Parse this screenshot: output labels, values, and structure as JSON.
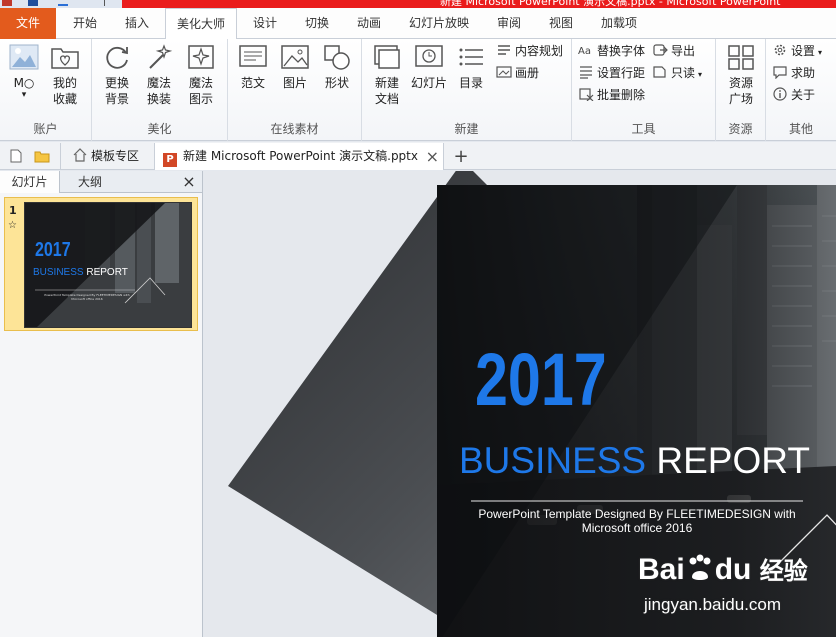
{
  "titlebar": {
    "title": "新建 Microsoft PowerPoint 演示文稿.pptx - Microsoft PowerPoint"
  },
  "ribbon_tabs": [
    {
      "label": "文件"
    },
    {
      "label": "开始"
    },
    {
      "label": "插入"
    },
    {
      "label": "美化大师"
    },
    {
      "label": "设计"
    },
    {
      "label": "切换"
    },
    {
      "label": "动画"
    },
    {
      "label": "幻灯片放映"
    },
    {
      "label": "审阅"
    },
    {
      "label": "视图"
    },
    {
      "label": "加载项"
    }
  ],
  "groups": {
    "account": {
      "label": "账户",
      "user_label": "M○",
      "favorites_label": "我的\n收藏",
      "dropdown_caret": "▾"
    },
    "beautify": {
      "label": "美化",
      "bg_label": "更换\n背景",
      "magic_change_label": "魔法\n换装",
      "magic_chart_label": "魔法\n图示"
    },
    "online": {
      "label": "在线素材",
      "template_label": "范文",
      "picture_label": "图片",
      "shape_label": "形状"
    },
    "new": {
      "label": "新建",
      "newdoc_label": "新建\n文档",
      "slide_label": "幻灯片",
      "toc_label": "目录",
      "content_plan_label": "内容规划",
      "album_label": "画册"
    },
    "tools": {
      "label": "工具",
      "replace_font_label": "替换字体",
      "line_spacing_label": "设置行距",
      "batch_delete_label": "批量删除",
      "export_label": "导出",
      "readonly_label": "只读"
    },
    "resources": {
      "label": "资源",
      "square_label": "资源\n广场"
    },
    "other": {
      "label": "其他",
      "settings_label": "设置",
      "help_label": "求助",
      "about_label": "关于"
    }
  },
  "doctabs": {
    "template_zone": "模板专区",
    "file_name": "新建 Microsoft PowerPoint 演示文稿.pptx",
    "close_glyph": "×",
    "new_glyph": "+"
  },
  "leftpane": {
    "tab_slides": "幻灯片",
    "tab_outline": "大纲",
    "close_glyph": "×",
    "slide_number": "1",
    "slide_star": "☆"
  },
  "slide": {
    "year": "2017",
    "title_blue": "BUSINESS",
    "title_white": "REPORT",
    "subtitle_line1": "PowerPoint Template Designed By FLEETIMEDESIGN with",
    "subtitle_line2": "Microsoft office 2016"
  },
  "watermark": {
    "brand": "Bai",
    "brand2": "du",
    "brand_cn": "经验",
    "url": "jingyan.baidu.com"
  },
  "colors": {
    "file_tab": "#e35b1d",
    "titlebar_red": "#ea1c1c",
    "thumb_selected": "#fde497",
    "slide_blue": "#1e78e8"
  }
}
